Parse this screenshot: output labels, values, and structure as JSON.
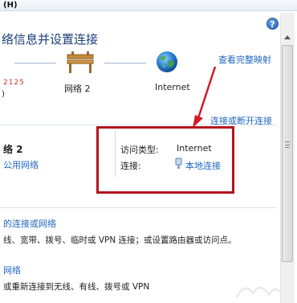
{
  "menu": {
    "help_menu": "(H)"
  },
  "header": {
    "title": "络信息并设置连接",
    "view_full_map": "查看完整映射"
  },
  "network_map": {
    "left_partial_name": "2125",
    "left_partial_suffix": ")",
    "network_label": "网络  2",
    "internet_label": "Internet"
  },
  "connect_disconnect": "连接或断开连接",
  "active_network": {
    "name_partial": "络  2",
    "type_partial": "公用网络",
    "access_type_label": "访问类型:",
    "access_type_value": "Internet",
    "connection_label": "连接:",
    "connection_value": "本地连接"
  },
  "settings": {
    "setup_new_link": "的连接或网络",
    "setup_new_desc": "线、宽带、拨号、临时或 VPN 连接；或设置路由器或访问点。",
    "connect_link": "网络",
    "connect_desc": "或重新连接到无线、有线、拨号或 VPN"
  },
  "colors": {
    "highlight_border": "#b31420",
    "link": "#1f66c2"
  }
}
